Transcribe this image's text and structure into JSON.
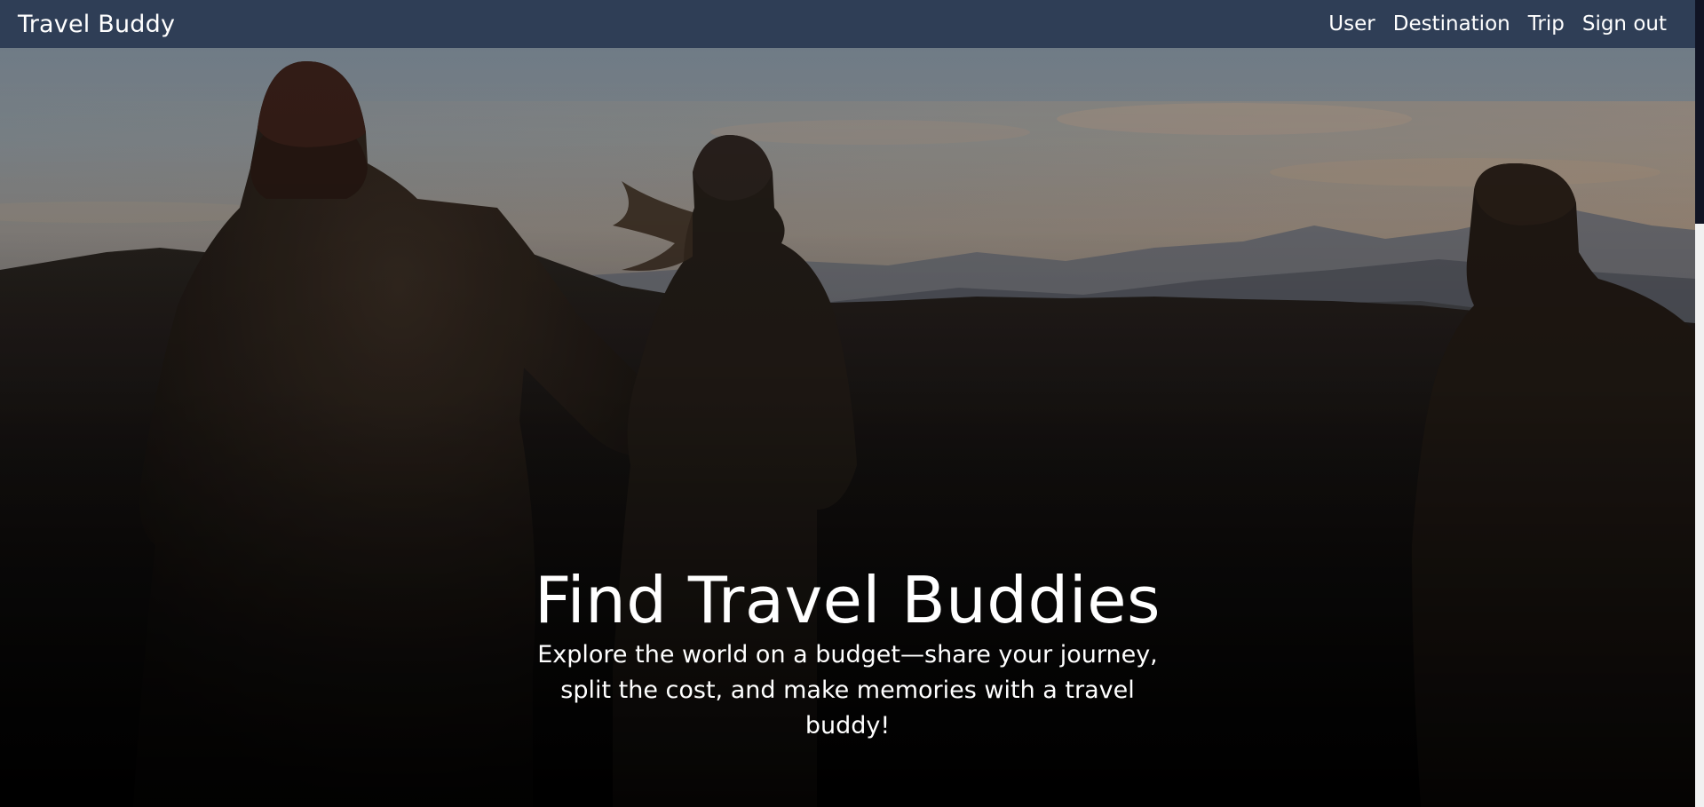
{
  "navbar": {
    "brand": "Travel Buddy",
    "links": [
      {
        "label": "User"
      },
      {
        "label": "Destination"
      },
      {
        "label": "Trip"
      },
      {
        "label": "Sign out"
      }
    ],
    "background": "#2f3e56"
  },
  "hero": {
    "title": "Find Travel Buddies",
    "subtitle": "Explore the world on a budget—share your journey, split the cost, and make memories with a travel buddy!"
  }
}
